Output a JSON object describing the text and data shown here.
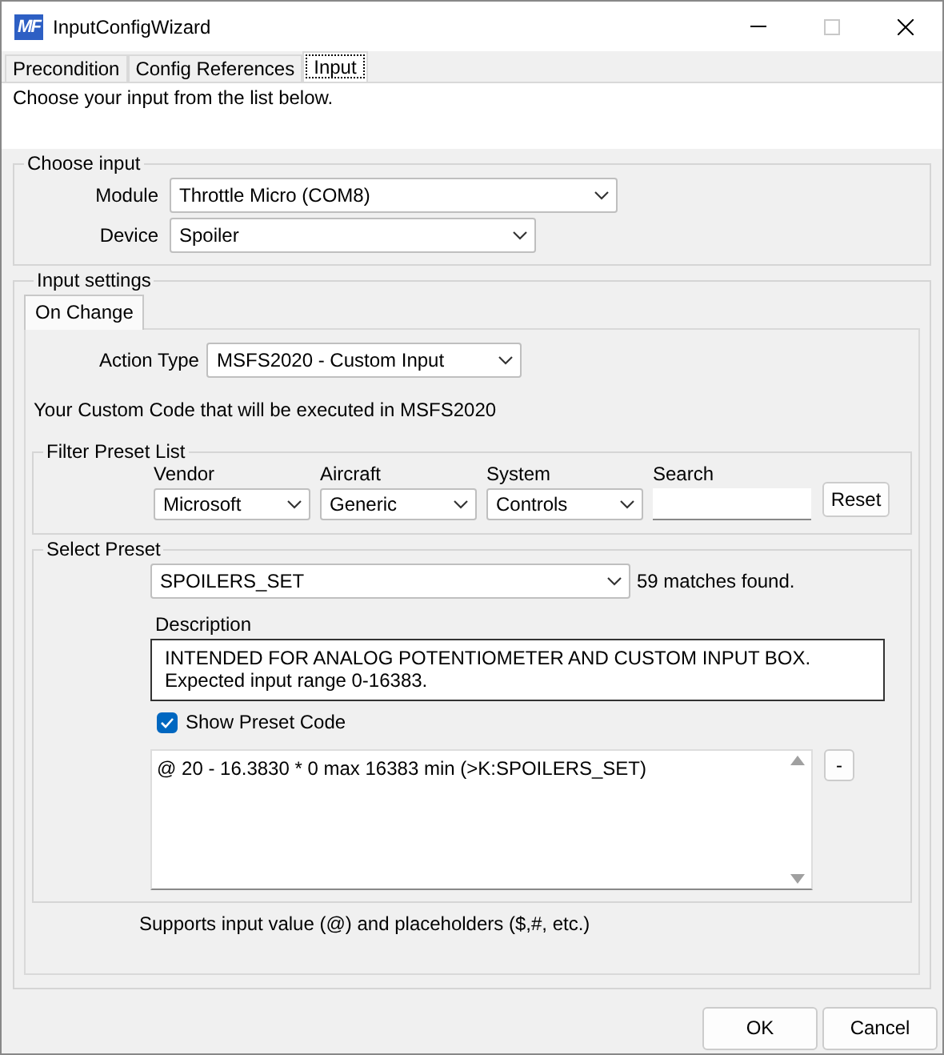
{
  "window": {
    "title": "InputConfigWizard",
    "logo_text": "MF",
    "maximize_disabled": true
  },
  "tabs": [
    {
      "label": "Precondition",
      "selected": false
    },
    {
      "label": "Config References",
      "selected": false
    },
    {
      "label": "Input",
      "selected": true
    }
  ],
  "instruction": "Choose your input from the list below.",
  "choose_input": {
    "title": "Choose input",
    "fields": [
      {
        "label": "Module",
        "value": "Throttle Micro (COM8)"
      },
      {
        "label": "Device",
        "value": "Spoiler"
      }
    ]
  },
  "input_settings": {
    "title": "Input settings",
    "tabs": [
      {
        "label": "On Change",
        "selected": true
      }
    ],
    "action_type": {
      "label": "Action Type",
      "value": "MSFS2020 - Custom Input"
    },
    "note": "Your Custom Code that will be executed in MSFS2020",
    "filter": {
      "title": "Filter Preset List",
      "filters": [
        {
          "kind": "dropdown",
          "label": "Vendor",
          "value": "Microsoft"
        },
        {
          "kind": "dropdown",
          "label": "Aircraft",
          "value": "Generic"
        },
        {
          "kind": "dropdown",
          "label": "System",
          "value": "Controls"
        },
        {
          "kind": "text",
          "label": "Search"
        }
      ],
      "reset_button": "Reset"
    },
    "select_preset": {
      "title": "Select Preset",
      "preset": "SPOILERS_SET",
      "matches": "59 matches found.",
      "description_label": "Description",
      "description": [
        "INTENDED FOR ANALOG POTENTIOMETER AND CUSTOM INPUT BOX.",
        "Expected input range 0-16383."
      ],
      "show_code": {
        "label": "Show Preset Code",
        "checked": true
      },
      "code": "@ 20 - 16.3830 * 0 max 16383 min (>K:SPOILERS_SET)",
      "collapse_button": "-"
    },
    "hint": "Supports input value (@) and placeholders ($,#, etc.)"
  },
  "buttons": [
    "OK",
    "Cancel"
  ]
}
